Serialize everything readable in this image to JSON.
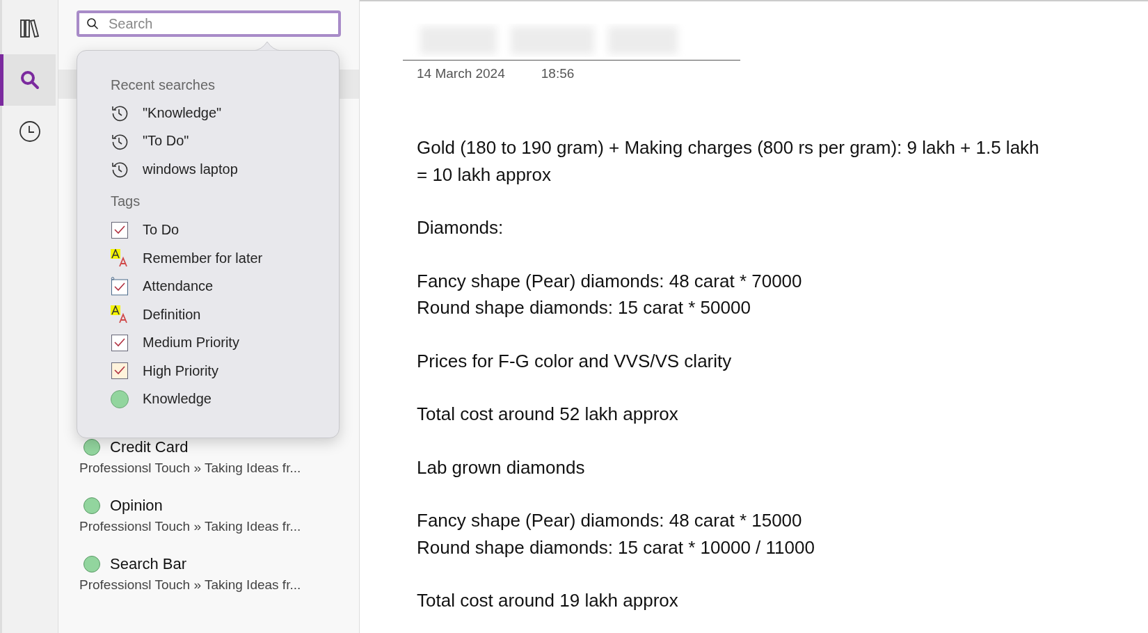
{
  "rail": {
    "items": [
      {
        "kind": "library",
        "selected": false
      },
      {
        "kind": "search",
        "selected": true
      },
      {
        "kind": "history",
        "selected": false
      }
    ]
  },
  "search": {
    "placeholder": "Search"
  },
  "dropdown": {
    "recent_heading": "Recent searches",
    "recent": [
      "\"Knowledge\"",
      "\"To Do\"",
      "windows laptop"
    ],
    "tags_heading": "Tags",
    "tags": [
      {
        "kind": "checkbox",
        "label": "To Do",
        "color": "#ffffff"
      },
      {
        "kind": "highlight",
        "label": "Remember for later"
      },
      {
        "kind": "attendance",
        "label": "Attendance"
      },
      {
        "kind": "highlight",
        "label": "Definition"
      },
      {
        "kind": "checkbox",
        "label": "Medium Priority",
        "color": "#ffffff"
      },
      {
        "kind": "checkbox",
        "label": "High Priority",
        "color": "#fff3dc"
      },
      {
        "kind": "dot",
        "label": "Knowledge",
        "color": "#92d59e"
      }
    ]
  },
  "results": [
    {
      "title": "Credit Card",
      "path": "Professionsl Touch » Taking Ideas fr...",
      "color": "#92d59e"
    },
    {
      "title": "Opinion",
      "path": "Professionsl Touch » Taking Ideas fr...",
      "color": "#92d59e"
    },
    {
      "title": "Search Bar",
      "path": "Professionsl Touch » Taking Ideas fr...",
      "color": "#92d59e"
    }
  ],
  "note": {
    "date": "14 March 2024",
    "time": "18:56",
    "paragraphs": [
      [
        "Gold (180 to 190 gram) + Making charges (800 rs per gram): 9 lakh + 1.5 lakh = 10 lakh approx"
      ],
      [
        "Diamonds:"
      ],
      [
        "Fancy shape (Pear) diamonds: 48 carat * 70000",
        "Round shape diamonds: 15 carat * 50000"
      ],
      [
        "Prices for F-G color and VVS/VS clarity"
      ],
      [
        "Total cost around 52 lakh approx"
      ],
      [
        "Lab grown diamonds"
      ],
      [
        "Fancy shape (Pear) diamonds: 48 carat * 15000",
        "Round shape diamonds: 15 carat * 10000 / 11000"
      ],
      [
        "Total cost around 19 lakh approx"
      ]
    ]
  }
}
